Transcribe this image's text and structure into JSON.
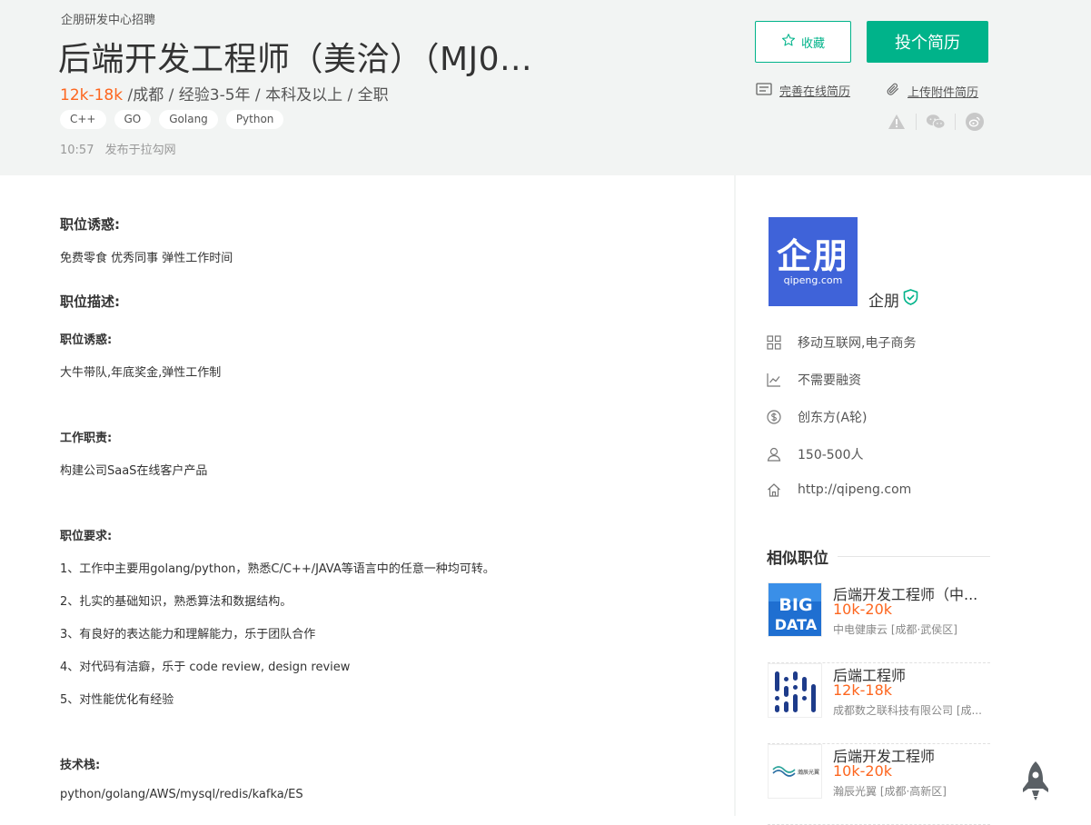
{
  "header": {
    "company_line": "企朋研发中心招聘",
    "title": "后端开发工程师（美洽）（MJ0...",
    "salary": "12k-18k",
    "meta": "/成都 / 经验3-5年 / 本科及以上 / 全职",
    "tags": [
      "C++",
      "GO",
      "Golang",
      "Python"
    ],
    "publish_time": "10:57",
    "publish_source": "发布于拉勾网",
    "collect_label": "收藏",
    "apply_label": "投个简历",
    "complete_resume_label": "完善在线简历",
    "upload_resume_label": "上传附件简历",
    "accent_color": "#00b38a",
    "salary_color": "#fd661f"
  },
  "main": {
    "perk_title": "职位诱惑:",
    "perk_text": "免费零食 优秀同事 弹性工作时间",
    "desc_title": "职位描述:",
    "desc_lines": [
      "职位诱惑:",
      "大牛带队,年底奖金,弹性工作制",
      "工作职责:",
      "构建公司SaaS在线客户产品",
      "职位要求:",
      "1、工作中主要用golang/python，熟悉C/C++/JAVA等语言中的任意一种均可转。",
      "2、扎实的基础知识，熟悉算法和数据结构。",
      "3、有良好的表达能力和理解能力，乐于团队合作",
      "4、对代码有洁癖，乐于 code review, design review",
      "5、对性能优化有经验",
      "技术栈:",
      "python/golang/AWS/mysql/redis/kafka/ES"
    ]
  },
  "company": {
    "logo_cn": "企朋",
    "logo_en": "qipeng.com",
    "logo_color": "#3f63d9",
    "name": "企朋",
    "field": "移动互联网,电子商务",
    "financing": "不需要融资",
    "investor": "创东方(A轮)",
    "size": "150-500人",
    "site": "http://qipeng.com"
  },
  "similar": {
    "title": "相似职位",
    "items": [
      {
        "title": "后端开发工程师（中...",
        "salary": "10k-20k",
        "company": "中电健康云 [成都·武侯区]",
        "thumb": "BIG DATA"
      },
      {
        "title": "后端工程师",
        "salary": "12k-18k",
        "company": "成都数之联科技有限公司 [成...",
        "thumb": ""
      },
      {
        "title": "后端开发工程师",
        "salary": "10k-20k",
        "company": "瀚辰光翼 [成都·高新区]",
        "thumb": "瀚辰光翼"
      }
    ]
  }
}
